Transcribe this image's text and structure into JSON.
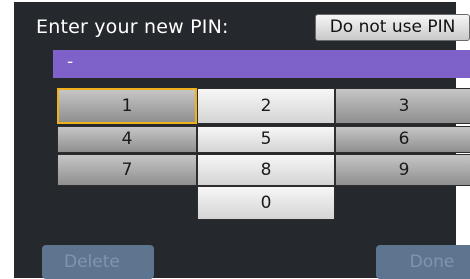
{
  "header": {
    "prompt": "Enter your new PIN:",
    "no_pin_label": "Do not use PIN"
  },
  "pin_field": {
    "value": "-"
  },
  "keypad": {
    "keys": [
      "1",
      "2",
      "3",
      "4",
      "5",
      "6",
      "7",
      "8",
      "9",
      "0"
    ],
    "selected_key": "1"
  },
  "footer": {
    "delete_label": "Delete",
    "done_label": "Done"
  },
  "colors": {
    "screen_bg": "#25282c",
    "pin_field": "#7e62c9",
    "selection_border": "#f0b21a",
    "disabled_button": "#5e7590"
  }
}
